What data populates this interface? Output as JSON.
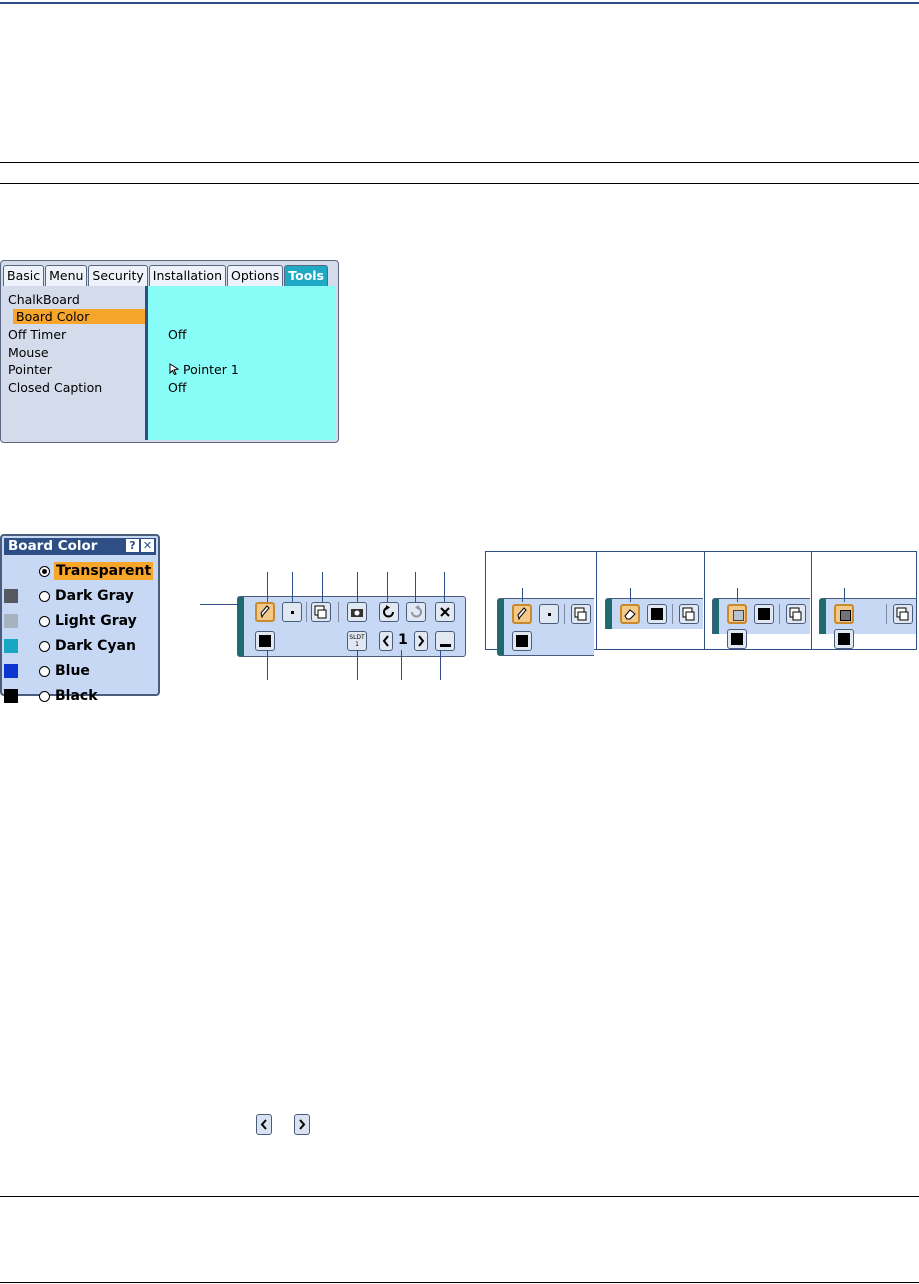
{
  "menu": {
    "tabs": [
      "Basic",
      "Menu",
      "Security",
      "Installation",
      "Options",
      "Tools"
    ],
    "active_tab": "Tools",
    "items": [
      "ChalkBoard",
      "Board Color",
      "Off Timer",
      "Mouse",
      "Pointer",
      "Closed Caption"
    ],
    "selected_item": "Board Color",
    "values": {
      "off_timer": "Off",
      "pointer": "Pointer 1",
      "closed_caption": "Off"
    }
  },
  "board_color_dialog": {
    "title": "Board Color",
    "help_glyph": "?",
    "close_glyph": "✕",
    "options": [
      {
        "label": "Transparent",
        "color": "",
        "selected": true
      },
      {
        "label": "Dark Gray",
        "color": "#555a60",
        "selected": false
      },
      {
        "label": "Light Gray",
        "color": "#a6b2c0",
        "selected": false
      },
      {
        "label": "Dark Cyan",
        "color": "#16a8c2",
        "selected": false
      },
      {
        "label": "Blue",
        "color": "#0c36d0",
        "selected": false
      },
      {
        "label": "Black",
        "color": "#000000",
        "selected": false
      }
    ]
  },
  "chalkboard_toolbar": {
    "slide_button_label": "SLDT",
    "slide_button_number": "1",
    "page_number": "1",
    "icons": [
      "pen-icon",
      "point-size-icon",
      "screen-capture-icon",
      "camera-icon",
      "undo-icon",
      "redo-icon",
      "delete-icon",
      "color-icon",
      "prev-page-icon",
      "next-page-icon",
      "minimize-icon"
    ]
  },
  "colors": {
    "menu_bg": "#d4dcec",
    "content_bg": "#88fdf8",
    "highlight": "#f7a62b",
    "active_tab": "#1ea9c4",
    "title_bar": "#2e4f86"
  }
}
